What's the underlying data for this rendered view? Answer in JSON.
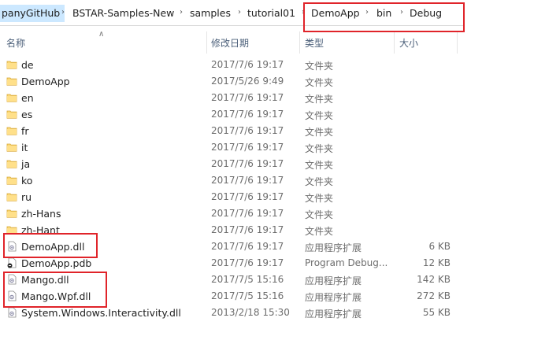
{
  "breadcrumb": [
    "panyGitHub",
    "BSTAR-Samples-New",
    "samples",
    "tutorial01",
    "DemoApp",
    "bin",
    "Debug"
  ],
  "columns": {
    "name": "名称",
    "date": "修改日期",
    "type": "类型",
    "size": "大小"
  },
  "highlight_color": "#e0242a",
  "files": [
    {
      "name": "de",
      "date": "2017/7/6 19:17",
      "type": "文件夹",
      "size": "",
      "icon": "folder-icon"
    },
    {
      "name": "DemoApp",
      "date": "2017/5/26 9:49",
      "type": "文件夹",
      "size": "",
      "icon": "folder-icon"
    },
    {
      "name": "en",
      "date": "2017/7/6 19:17",
      "type": "文件夹",
      "size": "",
      "icon": "folder-icon"
    },
    {
      "name": "es",
      "date": "2017/7/6 19:17",
      "type": "文件夹",
      "size": "",
      "icon": "folder-icon"
    },
    {
      "name": "fr",
      "date": "2017/7/6 19:17",
      "type": "文件夹",
      "size": "",
      "icon": "folder-icon"
    },
    {
      "name": "it",
      "date": "2017/7/6 19:17",
      "type": "文件夹",
      "size": "",
      "icon": "folder-icon"
    },
    {
      "name": "ja",
      "date": "2017/7/6 19:17",
      "type": "文件夹",
      "size": "",
      "icon": "folder-icon"
    },
    {
      "name": "ko",
      "date": "2017/7/6 19:17",
      "type": "文件夹",
      "size": "",
      "icon": "folder-icon"
    },
    {
      "name": "ru",
      "date": "2017/7/6 19:17",
      "type": "文件夹",
      "size": "",
      "icon": "folder-icon"
    },
    {
      "name": "zh-Hans",
      "date": "2017/7/6 19:17",
      "type": "文件夹",
      "size": "",
      "icon": "folder-icon"
    },
    {
      "name": "zh-Hant",
      "date": "2017/7/6 19:17",
      "type": "文件夹",
      "size": "",
      "icon": "folder-icon"
    },
    {
      "name": "DemoApp.dll",
      "date": "2017/7/6 19:17",
      "type": "应用程序扩展",
      "size": "6 KB",
      "icon": "dll-file-icon"
    },
    {
      "name": "DemoApp.pdb",
      "date": "2017/7/6 19:17",
      "type": "Program Debug...",
      "size": "12 KB",
      "icon": "pdb-file-icon"
    },
    {
      "name": "Mango.dll",
      "date": "2017/7/5 15:16",
      "type": "应用程序扩展",
      "size": "142 KB",
      "icon": "dll-file-icon"
    },
    {
      "name": "Mango.Wpf.dll",
      "date": "2017/7/5 15:16",
      "type": "应用程序扩展",
      "size": "272 KB",
      "icon": "dll-file-icon"
    },
    {
      "name": "System.Windows.Interactivity.dll",
      "date": "2013/2/18 15:30",
      "type": "应用程序扩展",
      "size": "55 KB",
      "icon": "dll-file-icon"
    }
  ]
}
